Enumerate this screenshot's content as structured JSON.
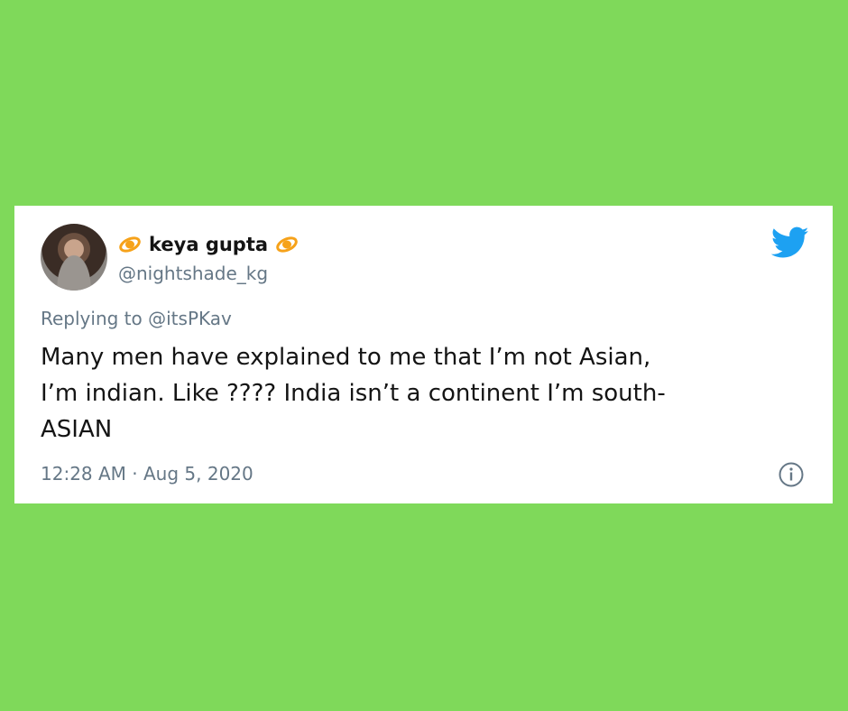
{
  "tweet": {
    "display_name": "keya gupta",
    "handle": "@nightshade_kg",
    "replying_prefix": "Replying to ",
    "replying_to": "@itsPKav",
    "text": "Many men have explained to me that I’m not Asian,\nI’m indian. Like ???? India isn’t a continent I’m south-\nASIAN",
    "timestamp": "12:28 AM · Aug 5, 2020"
  },
  "icons": {
    "name_emoji": "ringed-planet-icon",
    "brand": "twitter-bird-icon",
    "info": "info-icon"
  },
  "colors": {
    "background": "#7fd95a",
    "card": "#ffffff",
    "text": "#141414",
    "muted": "#657786",
    "twitter_blue": "#1da1f2",
    "emoji_orange": "#f6a21a"
  }
}
